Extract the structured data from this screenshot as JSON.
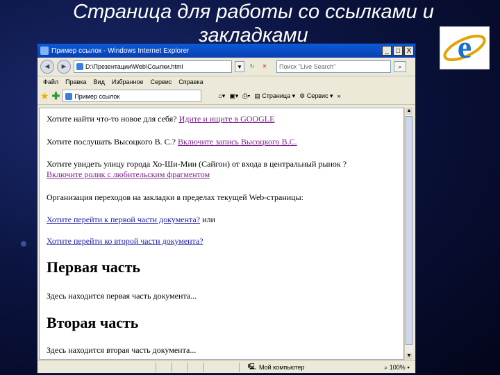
{
  "slide": {
    "title_line1": "Страница для работы со ссылками и",
    "title_line2": "закладками"
  },
  "window": {
    "title": "Пример ссылок - Windows Internet Explorer",
    "min_btn": "_",
    "max_btn": "□",
    "close_btn": "X"
  },
  "addressbar": {
    "back": "◄",
    "forward": "►",
    "url": "D:\\Презентации\\Web\\Ссылки.html",
    "search_placeholder": "Поиск \"Live Search\""
  },
  "menu": [
    "Файл",
    "Правка",
    "Вид",
    "Избранное",
    "Сервис",
    "Справка"
  ],
  "tab": {
    "label": "Пример ссылок"
  },
  "toolbar": {
    "page_label": "Страница",
    "tools_label": "Сервис"
  },
  "content": {
    "q1_text": "Хотите найти что-то новое для себя? ",
    "q1_link": "Идите и ищите в GOOGLE",
    "q2_text": "Хотите послушать Высоцкого В. С.? ",
    "q2_link": "Включите запись Высоцкого В.С.",
    "q3_text": "Хотите увидеть улицу города Хо-Ши-Мин (Сайгон) от входа в центральный рынок ?",
    "q3_link": "Включите ролик с любительским фрагментом",
    "q4_text": "Организация переходов на закладки в пределах текущей Web-страницы:",
    "q5_link": "Хотите перейти к первой части документа?",
    "q5_suffix": " или",
    "q6_link": "Хотите перейти ко второй части документа?",
    "h_part1": "Первая часть",
    "p_part1": "Здесь находится первая часть документа...",
    "h_part2": "Вторая часть",
    "p_part2": "Здесь находится вторая часть документа..."
  },
  "statusbar": {
    "zone": "Мой компьютер",
    "zoom": "100%"
  }
}
